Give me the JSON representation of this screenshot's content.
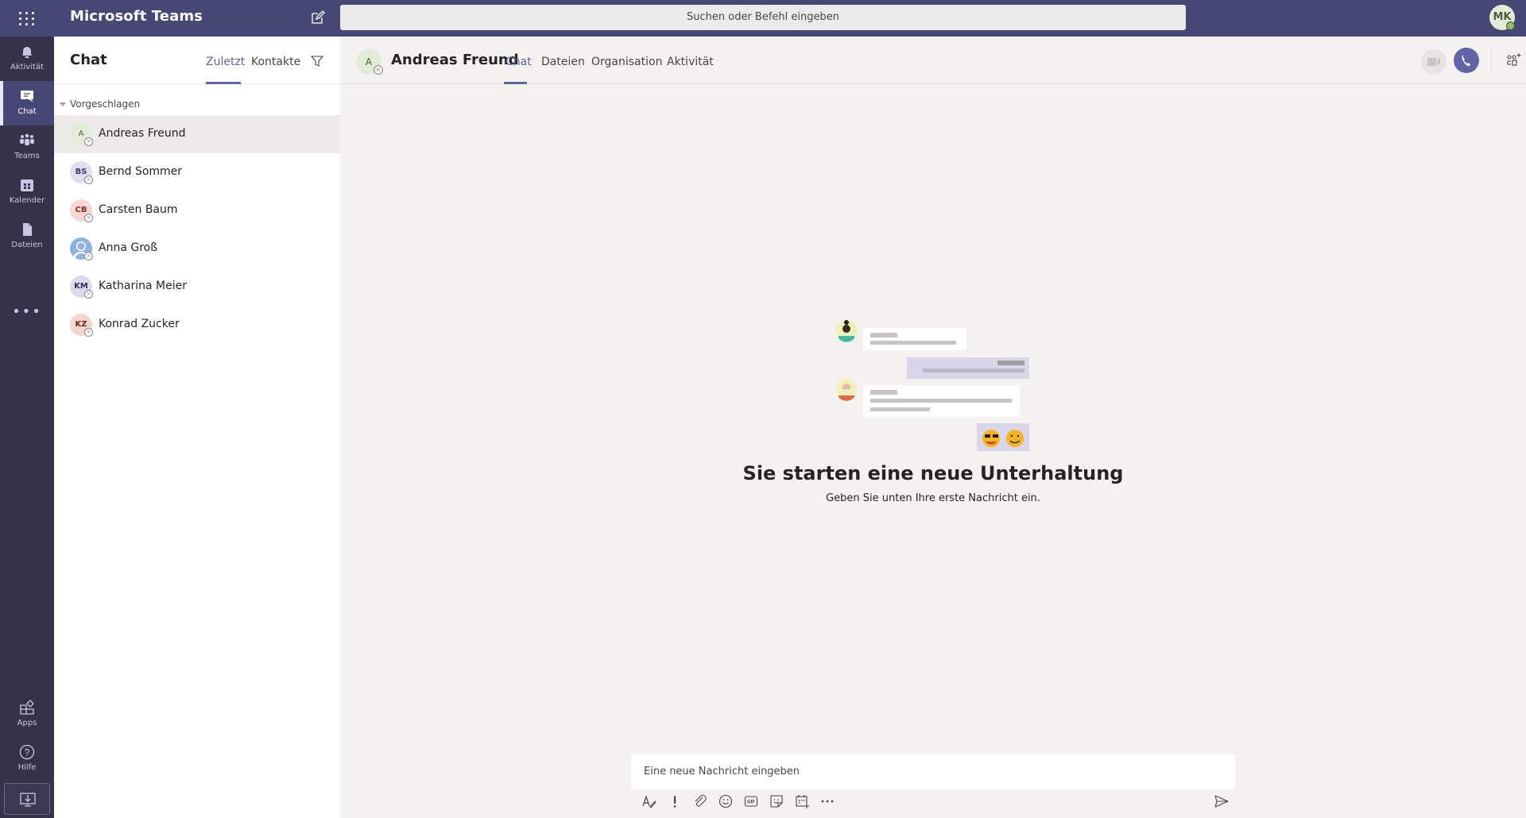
{
  "app": {
    "title": "Microsoft Teams",
    "search_placeholder": "Suchen oder Befehl eingeben",
    "user_initials": "MK",
    "user_status": "available",
    "status_color": "#92c353",
    "accent_color": "#6264a7",
    "topbar_color": "#464775"
  },
  "rail": {
    "items": [
      {
        "id": "activity",
        "label": "Aktivität",
        "icon": "bell-icon",
        "active": false
      },
      {
        "id": "chat",
        "label": "Chat",
        "icon": "chat-icon",
        "active": true
      },
      {
        "id": "teams",
        "label": "Teams",
        "icon": "teams-icon",
        "active": false
      },
      {
        "id": "calendar",
        "label": "Kalender",
        "icon": "calendar-icon",
        "active": false
      },
      {
        "id": "files",
        "label": "Dateien",
        "icon": "file-icon",
        "active": false
      }
    ],
    "more_label": "•••",
    "bottom": [
      {
        "id": "apps",
        "label": "Apps",
        "icon": "apps-icon"
      },
      {
        "id": "help",
        "label": "Hilfe",
        "icon": "help-icon"
      }
    ],
    "download_icon": "download-icon"
  },
  "chat_list": {
    "title": "Chat",
    "tabs": [
      {
        "label": "Zuletzt",
        "active": true
      },
      {
        "label": "Kontakte",
        "active": false
      }
    ],
    "section_label": "Vorgeschlagen",
    "contacts": [
      {
        "name": "Andreas Freund",
        "initials": "A",
        "bg": "#e3ecd9",
        "fg": "#4a5e3a",
        "selected": true
      },
      {
        "name": "Bernd Sommer",
        "initials": "BS",
        "bg": "#e1dfee",
        "fg": "#3d3e66",
        "selected": false
      },
      {
        "name": "Carsten Baum",
        "initials": "CB",
        "bg": "#f6d7d2",
        "fg": "#8e2f21",
        "selected": false
      },
      {
        "name": "Anna Groß",
        "initials": "",
        "bg": "#8fb3de",
        "fg": "#ffffff",
        "selected": false,
        "photo_placeholder": true
      },
      {
        "name": "Katharina Meier",
        "initials": "KM",
        "bg": "#dcdaef",
        "fg": "#2f2f5c",
        "selected": false
      },
      {
        "name": "Konrad Zucker",
        "initials": "KZ",
        "bg": "#f4d6cf",
        "fg": "#6e2418",
        "selected": false
      }
    ]
  },
  "conversation": {
    "contact_name": "Andreas Freund",
    "contact_initials": "A",
    "tabs": [
      {
        "label": "Chat",
        "active": true
      },
      {
        "label": "Dateien",
        "active": false
      },
      {
        "label": "Organisation",
        "active": false
      },
      {
        "label": "Aktivität",
        "active": false
      }
    ],
    "empty_title": "Sie starten eine neue Unterhaltung",
    "empty_subtitle": "Geben Sie unten Ihre erste Nachricht ein.",
    "composer_placeholder": "Eine neue Nachricht eingeben",
    "toolbar": [
      "format-icon",
      "important-icon",
      "attach-icon",
      "emoji-icon",
      "gif-icon",
      "sticker-icon",
      "schedule-meeting-icon",
      "more-icon"
    ],
    "send_icon": "send-icon"
  }
}
